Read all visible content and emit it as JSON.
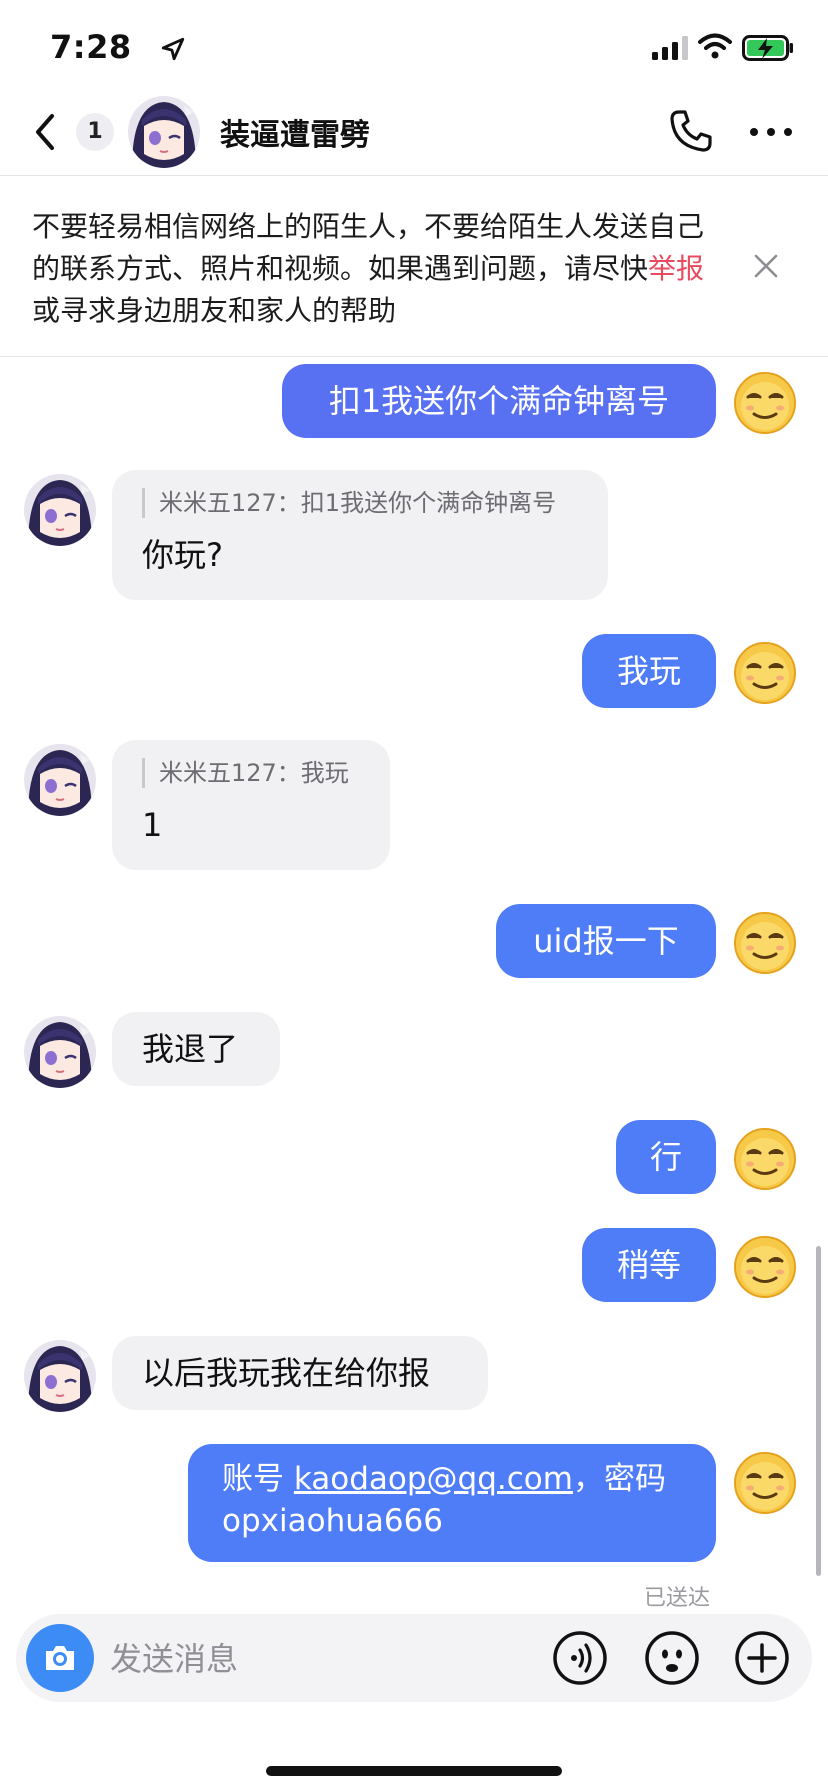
{
  "status_bar": {
    "time": "7:28",
    "battery_color": "#34c759"
  },
  "header": {
    "unread_count": "1",
    "contact_name": "装逼遭雷劈"
  },
  "notice": {
    "text_before": "不要轻易相信网络上的陌生人，不要给陌生人发送自己的联系方式、照片和视频。如果遇到问题，请尽快",
    "link": "举报",
    "text_after": "或寻求身边朋友和家人的帮助"
  },
  "messages": [
    {
      "from": "me",
      "text": "扣1我送你个满命钟离号"
    },
    {
      "from": "them",
      "quote": "米米五127：扣1我送你个满命钟离号",
      "text": "你玩?"
    },
    {
      "from": "me",
      "text": "我玩"
    },
    {
      "from": "them",
      "quote": "米米五127：我玩",
      "text": "1"
    },
    {
      "from": "me",
      "text": "uid报一下"
    },
    {
      "from": "them",
      "text": "我退了"
    },
    {
      "from": "me",
      "text": "行"
    },
    {
      "from": "me",
      "text": "稍等"
    },
    {
      "from": "them",
      "text": "以后我玩我在给你报"
    },
    {
      "from": "me",
      "text_prefix": "账号 ",
      "email": "kaodaop@qq.com",
      "text_mid": "，密码",
      "text_line2": "opxiaohua666"
    }
  ],
  "sent_status": "已送达",
  "composer": {
    "placeholder": "发送消息",
    "camera_color": "#3d8cf5"
  },
  "colors": {
    "outgoing_bubble": "#4f7cf7",
    "incoming_bubble": "#f1f1f4",
    "report_link": "#e84a5f"
  }
}
